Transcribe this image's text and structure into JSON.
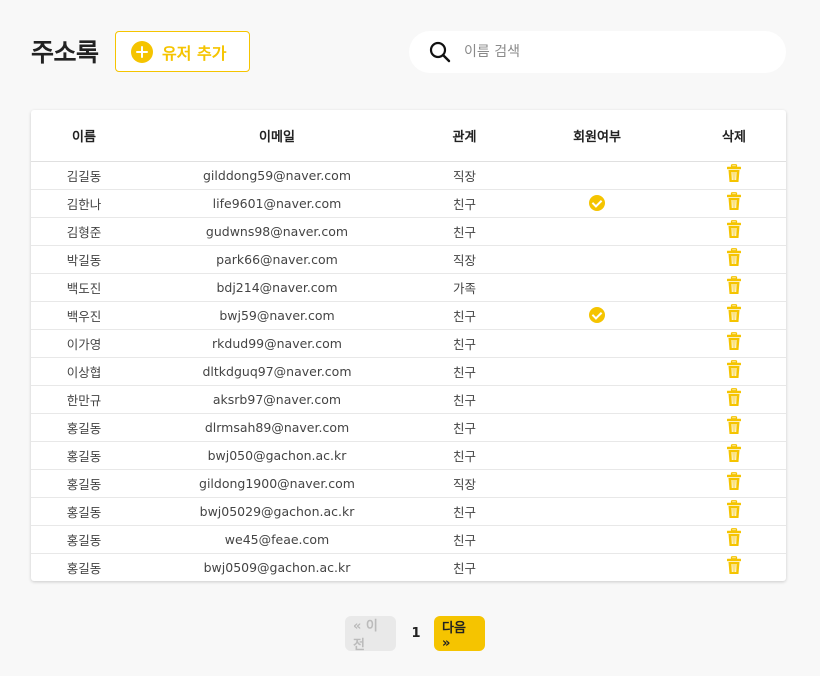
{
  "header": {
    "title": "주소록",
    "add_user_label": "유저 추가"
  },
  "search": {
    "placeholder": "이름 검색",
    "value": ""
  },
  "table": {
    "columns": [
      "이름",
      "이메일",
      "관계",
      "회원여부",
      "삭제"
    ],
    "rows": [
      {
        "name": "김길동",
        "email": "gilddong59@naver.com",
        "relation": "직장",
        "member": false
      },
      {
        "name": "김한나",
        "email": "life9601@naver.com",
        "relation": "친구",
        "member": true
      },
      {
        "name": "김형준",
        "email": "gudwns98@naver.com",
        "relation": "친구",
        "member": false
      },
      {
        "name": "박길동",
        "email": "park66@naver.com",
        "relation": "직장",
        "member": false
      },
      {
        "name": "백도진",
        "email": "bdj214@naver.com",
        "relation": "가족",
        "member": false
      },
      {
        "name": "백우진",
        "email": "bwj59@naver.com",
        "relation": "친구",
        "member": true
      },
      {
        "name": "이가영",
        "email": "rkdud99@naver.com",
        "relation": "친구",
        "member": false
      },
      {
        "name": "이상협",
        "email": "dltkdguq97@naver.com",
        "relation": "친구",
        "member": false
      },
      {
        "name": "한만규",
        "email": "aksrb97@naver.com",
        "relation": "친구",
        "member": false
      },
      {
        "name": "홍길동",
        "email": "dlrmsah89@naver.com",
        "relation": "친구",
        "member": false
      },
      {
        "name": "홍길동",
        "email": "bwj050@gachon.ac.kr",
        "relation": "친구",
        "member": false
      },
      {
        "name": "홍길동",
        "email": "gildong1900@naver.com",
        "relation": "직장",
        "member": false
      },
      {
        "name": "홍길동",
        "email": "bwj05029@gachon.ac.kr",
        "relation": "친구",
        "member": false
      },
      {
        "name": "홍길동",
        "email": "we45@feae.com",
        "relation": "친구",
        "member": false
      },
      {
        "name": "홍길동",
        "email": "bwj0509@gachon.ac.kr",
        "relation": "친구",
        "member": false
      }
    ],
    "member_icon": "check-circle-icon",
    "delete_icon": "trash-icon"
  },
  "pagination": {
    "prev_label": "« 이전",
    "current_page": "1",
    "next_label": "다음 »"
  },
  "colors": {
    "accent": "#f5c400",
    "background": "#f8f8f8"
  }
}
